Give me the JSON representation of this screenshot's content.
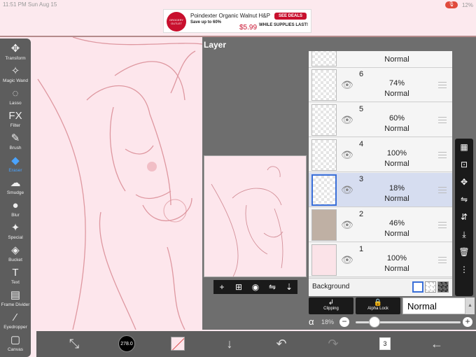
{
  "status": {
    "time": "11:51 PM",
    "date": "Sun Aug 15",
    "battery": "12%"
  },
  "ad": {
    "brand": "GROCERY OUTLET",
    "title": "Poindexter Organic Walnut H&P",
    "subtitle": "Save up to 60%",
    "price": "$5.99",
    "cta": "SEE DEALS",
    "note": "WHILE SUPPLIES LAST!"
  },
  "tools": [
    {
      "label": "Transform",
      "icon": "move-icon"
    },
    {
      "label": "Magic Wand",
      "icon": "magic-wand-icon"
    },
    {
      "label": "Lasso",
      "icon": "lasso-icon"
    },
    {
      "label": "Filter",
      "icon": "filter-icon"
    },
    {
      "label": "Brush",
      "icon": "brush-icon"
    },
    {
      "label": "Eraser",
      "icon": "eraser-icon"
    },
    {
      "label": "Smudge",
      "icon": "smudge-icon"
    },
    {
      "label": "Blur",
      "icon": "blur-icon"
    },
    {
      "label": "Special",
      "icon": "special-icon"
    },
    {
      "label": "Bucket",
      "icon": "bucket-icon"
    },
    {
      "label": "Text",
      "icon": "text-icon"
    },
    {
      "label": "Frame Divider",
      "icon": "frame-divider-icon"
    },
    {
      "label": "Eyedropper",
      "icon": "eyedropper-icon"
    },
    {
      "label": "Canvas",
      "icon": "canvas-icon"
    }
  ],
  "active_tool": "Eraser",
  "layer_panel": {
    "header": "Layer",
    "layers": [
      {
        "num": "",
        "opacity": "",
        "mode": "Normal"
      },
      {
        "num": "6",
        "opacity": "74%",
        "mode": "Normal"
      },
      {
        "num": "5",
        "opacity": "60%",
        "mode": "Normal"
      },
      {
        "num": "4",
        "opacity": "100%",
        "mode": "Normal"
      },
      {
        "num": "3",
        "opacity": "18%",
        "mode": "Normal"
      },
      {
        "num": "2",
        "opacity": "46%",
        "mode": "Normal"
      },
      {
        "num": "1",
        "opacity": "100%",
        "mode": "Normal"
      }
    ],
    "selected_layer": "3",
    "background_label": "Background",
    "clipping_label": "Clipping",
    "alpha_lock_label": "Alpha Lock",
    "blend_mode": "Normal",
    "alpha_symbol": "α",
    "alpha_value": "18%",
    "alpha_fraction": 0.18
  },
  "bottom": {
    "brush_size": "278.0",
    "page_count": "3"
  },
  "colors": {
    "toolbar": "#5d5d5d",
    "accent": "#3a6fd8",
    "canvas": "#fde6ec",
    "sketch": "#d98a93"
  }
}
